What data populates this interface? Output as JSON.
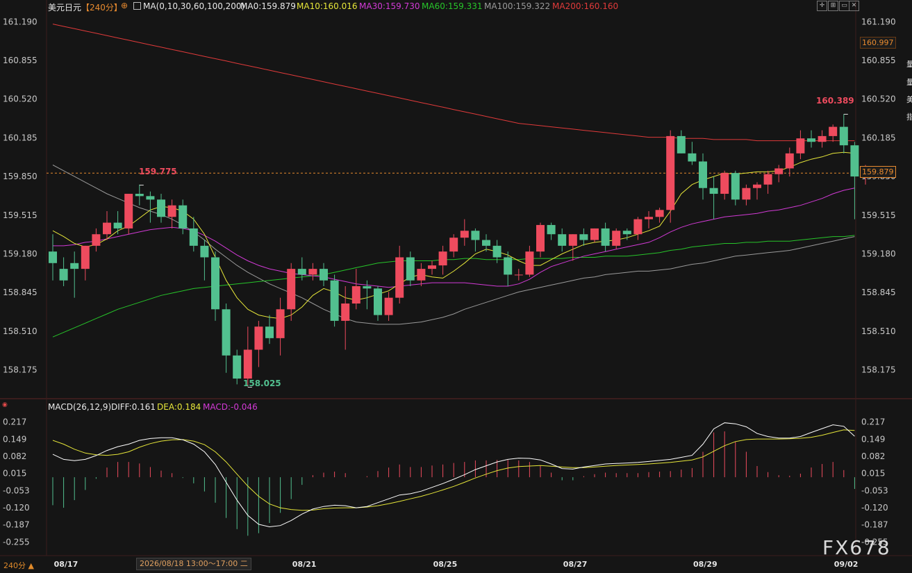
{
  "header": {
    "symbol": "美元日元",
    "period": "【240分】",
    "ma_label": "MA(0,10,30,60,100,200)",
    "ma0": "MA0:159.879",
    "ma10": "MA10:160.016",
    "ma30": "MA30:159.730",
    "ma60": "MA60:159.331",
    "ma100": "MA100:159.322",
    "ma200": "MA200:160.160"
  },
  "macd_header": {
    "label": "MACD(26,12,9)",
    "diff": "DIFF:0.161",
    "dea": "DEA:0.184",
    "macd": "MACD:-0.046"
  },
  "colors": {
    "up": "#ee4b5e",
    "down": "#52c08f",
    "ma10": "#e6e639",
    "ma30": "#d23ad6",
    "ma60": "#27c52a",
    "ma100": "#9a9a9a",
    "ma200": "#e03a3a",
    "diff": "#ffffff",
    "dea": "#e6e639"
  },
  "price_axis": {
    "ticks": [
      "161.190",
      "160.855",
      "160.520",
      "160.185",
      "159.850",
      "159.515",
      "159.180",
      "158.845",
      "158.510",
      "158.175"
    ],
    "tick_values": [
      161.19,
      160.855,
      160.52,
      160.185,
      159.85,
      159.515,
      159.18,
      158.845,
      158.51,
      158.175
    ],
    "current_price": "159.879",
    "marker_price": "160.997"
  },
  "macd_axis": {
    "ticks": [
      "0.217",
      "0.149",
      "0.082",
      "0.015",
      "-0.053",
      "-0.120",
      "-0.187",
      "-0.255"
    ],
    "tick_values": [
      0.217,
      0.149,
      0.082,
      0.015,
      -0.053,
      -0.12,
      -0.187,
      -0.255
    ]
  },
  "annotations": {
    "high_label": "160.389",
    "low_label": "158.025",
    "local_high_label": "159.775"
  },
  "x_axis": {
    "labels": [
      "08/17",
      "08/21",
      "08/25",
      "08/27",
      "08/29",
      "09/02"
    ]
  },
  "status": {
    "period_button": "240分 ▲",
    "crosshair_time": "2026/08/18 13:00～17:00 二"
  },
  "watermark": "FX678",
  "chart_data": {
    "type": "candlestick",
    "title": "美元日元",
    "period": "240分",
    "ohlc": [
      [
        159.2,
        159.35,
        158.95,
        159.1
      ],
      [
        159.05,
        159.15,
        158.9,
        158.95
      ],
      [
        159.1,
        159.2,
        158.8,
        159.05
      ],
      [
        159.05,
        159.25,
        158.95,
        159.25
      ],
      [
        159.25,
        159.4,
        159.2,
        159.35
      ],
      [
        159.35,
        159.55,
        159.3,
        159.45
      ],
      [
        159.45,
        159.55,
        159.35,
        159.4
      ],
      [
        159.4,
        159.7,
        159.35,
        159.7
      ],
      [
        159.7,
        159.78,
        159.6,
        159.68
      ],
      [
        159.68,
        159.72,
        159.45,
        159.65
      ],
      [
        159.65,
        159.7,
        159.45,
        159.5
      ],
      [
        159.5,
        159.65,
        159.4,
        159.6
      ],
      [
        159.6,
        159.65,
        159.35,
        159.4
      ],
      [
        159.4,
        159.5,
        159.2,
        159.25
      ],
      [
        159.25,
        159.3,
        158.95,
        159.15
      ],
      [
        159.15,
        159.2,
        158.6,
        158.7
      ],
      [
        158.7,
        158.75,
        158.15,
        158.3
      ],
      [
        158.3,
        158.35,
        158.05,
        158.1
      ],
      [
        158.1,
        158.55,
        158.03,
        158.35
      ],
      [
        158.35,
        158.6,
        158.2,
        158.55
      ],
      [
        158.55,
        158.65,
        158.4,
        158.45
      ],
      [
        158.45,
        158.8,
        158.3,
        158.7
      ],
      [
        158.7,
        159.1,
        158.6,
        159.05
      ],
      [
        159.05,
        159.15,
        158.95,
        159.0
      ],
      [
        159.0,
        159.1,
        158.95,
        159.05
      ],
      [
        159.05,
        159.1,
        158.9,
        158.95
      ],
      [
        158.95,
        159.0,
        158.55,
        158.6
      ],
      [
        158.6,
        158.9,
        158.35,
        158.75
      ],
      [
        158.75,
        159.05,
        158.7,
        158.9
      ],
      [
        158.9,
        158.95,
        158.7,
        158.88
      ],
      [
        158.88,
        158.9,
        158.6,
        158.65
      ],
      [
        158.65,
        158.85,
        158.6,
        158.8
      ],
      [
        158.8,
        159.25,
        158.75,
        159.15
      ],
      [
        159.15,
        159.2,
        158.9,
        158.95
      ],
      [
        158.95,
        159.1,
        158.9,
        159.05
      ],
      [
        159.05,
        159.12,
        159.0,
        159.08
      ],
      [
        159.08,
        159.25,
        159.0,
        159.2
      ],
      [
        159.2,
        159.35,
        159.15,
        159.32
      ],
      [
        159.32,
        159.48,
        159.25,
        159.38
      ],
      [
        159.38,
        159.4,
        159.2,
        159.3
      ],
      [
        159.3,
        159.35,
        159.2,
        159.25
      ],
      [
        159.25,
        159.3,
        159.1,
        159.15
      ],
      [
        159.15,
        159.2,
        158.9,
        159.0
      ],
      [
        159.0,
        159.05,
        158.95,
        159.0
      ],
      [
        159.0,
        159.25,
        158.98,
        159.2
      ],
      [
        159.2,
        159.45,
        159.15,
        159.43
      ],
      [
        159.43,
        159.45,
        159.3,
        159.35
      ],
      [
        159.35,
        159.4,
        159.2,
        159.25
      ],
      [
        159.25,
        159.35,
        159.12,
        159.35
      ],
      [
        159.35,
        159.4,
        159.25,
        159.3
      ],
      [
        159.3,
        159.4,
        159.28,
        159.4
      ],
      [
        159.4,
        159.45,
        159.2,
        159.25
      ],
      [
        159.25,
        159.4,
        159.22,
        159.38
      ],
      [
        159.38,
        159.4,
        159.3,
        159.35
      ],
      [
        159.35,
        159.5,
        159.3,
        159.48
      ],
      [
        159.48,
        159.55,
        159.4,
        159.5
      ],
      [
        159.5,
        159.58,
        159.45,
        159.56
      ],
      [
        159.56,
        160.25,
        159.45,
        160.2
      ],
      [
        160.2,
        160.25,
        160.05,
        160.05
      ],
      [
        160.05,
        160.15,
        159.95,
        159.98
      ],
      [
        159.98,
        160.05,
        159.65,
        159.75
      ],
      [
        159.75,
        159.85,
        159.48,
        159.7
      ],
      [
        159.7,
        159.9,
        159.65,
        159.88
      ],
      [
        159.88,
        159.9,
        159.6,
        159.65
      ],
      [
        159.65,
        159.78,
        159.6,
        159.75
      ],
      [
        159.75,
        159.8,
        159.65,
        159.78
      ],
      [
        159.78,
        159.9,
        159.7,
        159.87
      ],
      [
        159.87,
        159.95,
        159.8,
        159.92
      ],
      [
        159.92,
        160.1,
        159.85,
        160.05
      ],
      [
        160.05,
        160.25,
        160.0,
        160.18
      ],
      [
        160.18,
        160.25,
        160.1,
        160.15
      ],
      [
        160.15,
        160.25,
        160.1,
        160.2
      ],
      [
        160.2,
        160.3,
        160.15,
        160.28
      ],
      [
        160.28,
        160.39,
        160.05,
        160.12
      ],
      [
        160.12,
        160.15,
        159.48,
        159.85
      ],
      [
        159.85,
        159.95,
        159.78,
        159.88
      ]
    ],
    "ma10": [
      159.38,
      159.33,
      159.27,
      159.24,
      159.26,
      159.31,
      159.38,
      159.42,
      159.49,
      159.56,
      159.59,
      159.58,
      159.55,
      159.48,
      159.35,
      159.15,
      158.95,
      158.8,
      158.7,
      158.65,
      158.63,
      158.62,
      158.65,
      158.72,
      158.82,
      158.88,
      158.85,
      158.8,
      158.78,
      158.8,
      158.83,
      158.86,
      158.92,
      158.98,
      159.0,
      158.98,
      158.97,
      159.03,
      159.1,
      159.18,
      159.22,
      159.2,
      159.17,
      159.12,
      159.08,
      159.08,
      159.13,
      159.18,
      159.22,
      159.26,
      159.28,
      159.29,
      159.3,
      159.32,
      159.35,
      159.38,
      159.42,
      159.55,
      159.7,
      159.78,
      159.82,
      159.85,
      159.88,
      159.87,
      159.88,
      159.89,
      159.89,
      159.9,
      159.93,
      159.97,
      160.0,
      160.02,
      160.05,
      160.06,
      160.05
    ],
    "ma30": [
      159.25,
      159.25,
      159.26,
      159.28,
      159.29,
      159.31,
      159.33,
      159.35,
      159.37,
      159.39,
      159.4,
      159.41,
      159.4,
      159.38,
      159.34,
      159.29,
      159.23,
      159.17,
      159.12,
      159.08,
      159.05,
      159.03,
      159.01,
      159.0,
      158.99,
      158.98,
      158.96,
      158.94,
      158.92,
      158.91,
      158.9,
      158.89,
      158.9,
      158.91,
      158.92,
      158.93,
      158.93,
      158.93,
      158.93,
      158.92,
      158.91,
      158.9,
      158.9,
      158.92,
      158.96,
      159.02,
      159.07,
      159.1,
      159.13,
      159.16,
      159.18,
      159.2,
      159.22,
      159.24,
      159.26,
      159.28,
      159.32,
      159.37,
      159.41,
      159.44,
      159.46,
      159.48,
      159.5,
      159.51,
      159.52,
      159.53,
      159.55,
      159.56,
      159.58,
      159.6,
      159.63,
      159.66,
      159.7,
      159.73,
      159.75
    ],
    "ma60": [
      158.46,
      158.5,
      158.54,
      158.58,
      158.62,
      158.66,
      158.7,
      158.73,
      158.76,
      158.79,
      158.82,
      158.84,
      158.86,
      158.88,
      158.89,
      158.9,
      158.91,
      158.92,
      158.93,
      158.94,
      158.95,
      158.96,
      158.97,
      158.98,
      158.99,
      159.0,
      159.02,
      159.04,
      159.06,
      159.08,
      159.1,
      159.11,
      159.12,
      159.12,
      159.12,
      159.12,
      159.13,
      159.13,
      159.14,
      159.14,
      159.13,
      159.13,
      159.13,
      159.13,
      159.14,
      159.14,
      159.14,
      159.14,
      159.15,
      159.15,
      159.15,
      159.16,
      159.16,
      159.16,
      159.17,
      159.18,
      159.19,
      159.21,
      159.22,
      159.24,
      159.25,
      159.26,
      159.27,
      159.27,
      159.28,
      159.28,
      159.29,
      159.29,
      159.29,
      159.3,
      159.31,
      159.32,
      159.33,
      159.33,
      159.34
    ],
    "ma100": [
      159.95,
      159.9,
      159.85,
      159.8,
      159.75,
      159.7,
      159.66,
      159.62,
      159.58,
      159.55,
      159.52,
      159.48,
      159.43,
      159.37,
      159.3,
      159.22,
      159.15,
      159.08,
      159.02,
      158.97,
      158.92,
      158.88,
      158.84,
      158.8,
      158.75,
      158.7,
      158.66,
      158.62,
      158.59,
      158.58,
      158.57,
      158.57,
      158.57,
      158.58,
      158.59,
      158.61,
      158.63,
      158.66,
      158.7,
      158.73,
      158.76,
      158.79,
      158.82,
      158.85,
      158.87,
      158.89,
      158.91,
      158.93,
      158.95,
      158.97,
      158.98,
      159.0,
      159.01,
      159.02,
      159.03,
      159.03,
      159.04,
      159.05,
      159.07,
      159.09,
      159.1,
      159.12,
      159.14,
      159.16,
      159.17,
      159.18,
      159.19,
      159.2,
      159.21,
      159.23,
      159.25,
      159.27,
      159.29,
      159.31,
      159.33
    ],
    "ma200": [
      161.17,
      161.15,
      161.13,
      161.11,
      161.09,
      161.07,
      161.05,
      161.03,
      161.01,
      160.99,
      160.97,
      160.95,
      160.93,
      160.91,
      160.89,
      160.87,
      160.85,
      160.83,
      160.81,
      160.79,
      160.77,
      160.75,
      160.73,
      160.71,
      160.69,
      160.67,
      160.65,
      160.63,
      160.61,
      160.59,
      160.57,
      160.55,
      160.53,
      160.51,
      160.49,
      160.47,
      160.45,
      160.43,
      160.41,
      160.39,
      160.37,
      160.35,
      160.33,
      160.31,
      160.3,
      160.29,
      160.28,
      160.27,
      160.26,
      160.25,
      160.24,
      160.23,
      160.22,
      160.21,
      160.2,
      160.19,
      160.19,
      160.19,
      160.18,
      160.18,
      160.18,
      160.17,
      160.17,
      160.17,
      160.17,
      160.16,
      160.16,
      160.16,
      160.16,
      160.16,
      160.16,
      160.16,
      160.16,
      160.16,
      160.16
    ],
    "macd_diff": [
      0.09,
      0.07,
      0.065,
      0.07,
      0.085,
      0.105,
      0.12,
      0.13,
      0.145,
      0.152,
      0.155,
      0.155,
      0.147,
      0.13,
      0.1,
      0.05,
      -0.02,
      -0.09,
      -0.15,
      -0.185,
      -0.195,
      -0.19,
      -0.17,
      -0.145,
      -0.125,
      -0.115,
      -0.11,
      -0.112,
      -0.12,
      -0.115,
      -0.1,
      -0.085,
      -0.07,
      -0.065,
      -0.055,
      -0.04,
      -0.025,
      -0.008,
      0.01,
      0.03,
      0.045,
      0.06,
      0.07,
      0.075,
      0.074,
      0.068,
      0.052,
      0.034,
      0.032,
      0.04,
      0.046,
      0.052,
      0.054,
      0.056,
      0.058,
      0.062,
      0.066,
      0.07,
      0.078,
      0.086,
      0.13,
      0.19,
      0.214,
      0.21,
      0.198,
      0.172,
      0.16,
      0.154,
      0.154,
      0.16,
      0.176,
      0.191,
      0.206,
      0.2,
      0.161
    ],
    "macd_dea": [
      0.145,
      0.13,
      0.11,
      0.095,
      0.088,
      0.086,
      0.09,
      0.1,
      0.118,
      0.132,
      0.142,
      0.147,
      0.148,
      0.142,
      0.128,
      0.1,
      0.06,
      0.012,
      -0.035,
      -0.075,
      -0.105,
      -0.12,
      -0.127,
      -0.13,
      -0.129,
      -0.124,
      -0.121,
      -0.12,
      -0.12,
      -0.117,
      -0.112,
      -0.104,
      -0.095,
      -0.085,
      -0.075,
      -0.063,
      -0.05,
      -0.036,
      -0.02,
      -0.003,
      0.012,
      0.026,
      0.036,
      0.042,
      0.044,
      0.046,
      0.043,
      0.04,
      0.038,
      0.038,
      0.04,
      0.043,
      0.046,
      0.048,
      0.05,
      0.052,
      0.055,
      0.058,
      0.063,
      0.068,
      0.08,
      0.102,
      0.124,
      0.14,
      0.148,
      0.15,
      0.15,
      0.15,
      0.151,
      0.153,
      0.157,
      0.165,
      0.176,
      0.186,
      0.184
    ],
    "macd_hist": [
      -0.11,
      -0.12,
      -0.09,
      -0.05,
      -0.006,
      0.038,
      0.06,
      0.06,
      0.054,
      0.04,
      0.026,
      0.016,
      -0.003,
      -0.024,
      -0.056,
      -0.1,
      -0.16,
      -0.204,
      -0.23,
      -0.22,
      -0.18,
      -0.14,
      -0.086,
      -0.03,
      0.008,
      0.018,
      0.022,
      0.016,
      0.0,
      0.004,
      0.024,
      0.038,
      0.05,
      0.04,
      0.04,
      0.046,
      0.05,
      0.056,
      0.06,
      0.066,
      0.066,
      0.068,
      0.068,
      0.066,
      0.06,
      0.044,
      0.018,
      -0.012,
      -0.012,
      0.004,
      0.012,
      0.018,
      0.016,
      0.016,
      0.016,
      0.02,
      0.022,
      0.024,
      0.03,
      0.036,
      0.1,
      0.176,
      0.18,
      0.14,
      0.1,
      0.044,
      0.02,
      0.008,
      0.006,
      0.014,
      0.038,
      0.052,
      0.06,
      0.028,
      -0.046
    ],
    "price_ylim": [
      157.95,
      161.27
    ],
    "macd_ylim": [
      -0.3,
      0.265
    ],
    "x_labels": [
      "08/17",
      "08/21",
      "08/25",
      "08/27",
      "08/29",
      "09/02"
    ],
    "x_label_index": [
      1,
      23,
      36,
      48,
      60,
      73
    ],
    "annotated_points": {
      "high": {
        "index": 73,
        "value": 160.389
      },
      "low": {
        "index": 18,
        "value": 158.025
      },
      "local_high": {
        "index": 8,
        "value": 159.775
      }
    }
  }
}
